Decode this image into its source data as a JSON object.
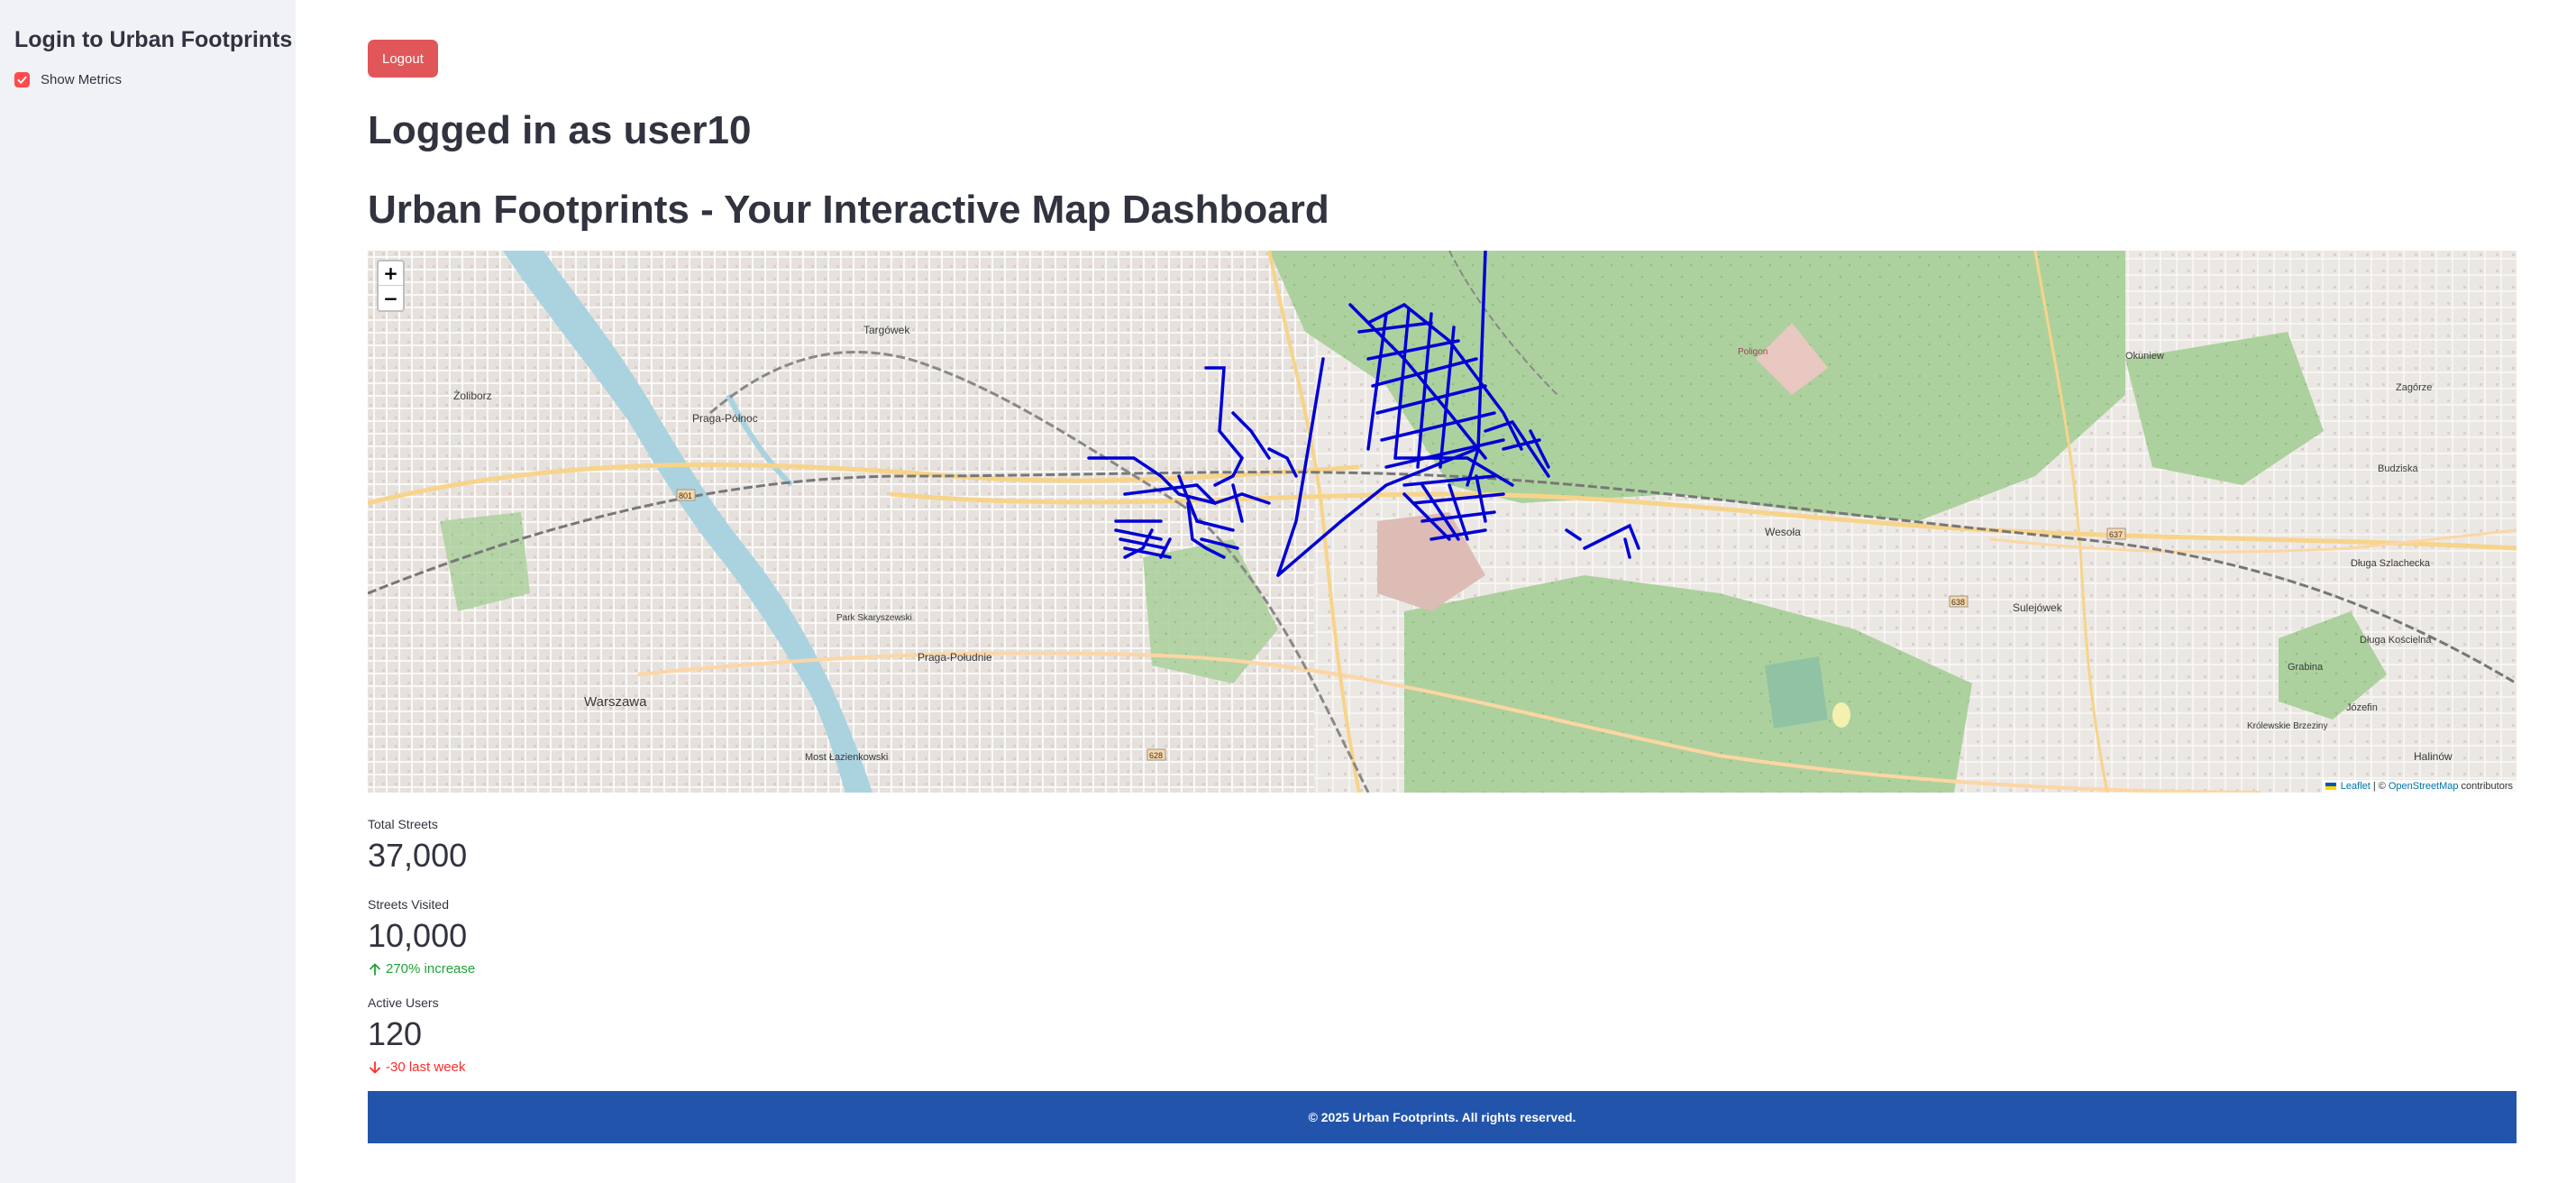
{
  "sidebar": {
    "title": "Login to Urban Footprints",
    "show_metrics_label": "Show Metrics",
    "show_metrics_checked": true
  },
  "main": {
    "logout_label": "Logout",
    "logged_in_text": "Logged in as user10",
    "dashboard_title": "Urban Footprints - Your Interactive Map Dashboard"
  },
  "map": {
    "zoom_in": "+",
    "zoom_out": "−",
    "attribution": {
      "leaflet": "Leaflet",
      "separator": "| ©",
      "osm": "OpenStreetMap",
      "contributors": "contributors"
    },
    "route_color": "#0000d6",
    "place_labels": {
      "zoliborz": "Żoliborz",
      "praga_polnoc": "Praga-Północ",
      "targowek": "Targówek",
      "warszawa": "Warszawa",
      "praga_poludnie": "Praga-Południe",
      "most": "Most Łazienkowski",
      "park_skaryszewski": "Park Skaryszewski",
      "wesola": "Wesoła",
      "sulejowek": "Sulejówek",
      "okuniew": "Okuniew",
      "zagorze": "Zagórze",
      "budziska": "Budziska",
      "dluga_szlachecka": "Długa Szlachecka",
      "dluga_koscielna": "Długa Kościelna",
      "grabina": "Grabina",
      "jozefin": "Józefin",
      "halinow": "Halinów",
      "krolewskie_brzeziny": "Królewskie Brzeziny",
      "poligon": "Poligon",
      "road_637": "637",
      "road_638": "638",
      "road_628": "628",
      "road_801": "801"
    }
  },
  "metrics": [
    {
      "label": "Total Streets",
      "value": "37,000"
    },
    {
      "label": "Streets Visited",
      "value": "10,000",
      "delta": "270% increase",
      "direction": "up"
    },
    {
      "label": "Active Users",
      "value": "120",
      "delta": "-30 last week",
      "direction": "down"
    }
  ],
  "footer": {
    "text": "© 2025 Urban Footprints. All rights reserved."
  }
}
